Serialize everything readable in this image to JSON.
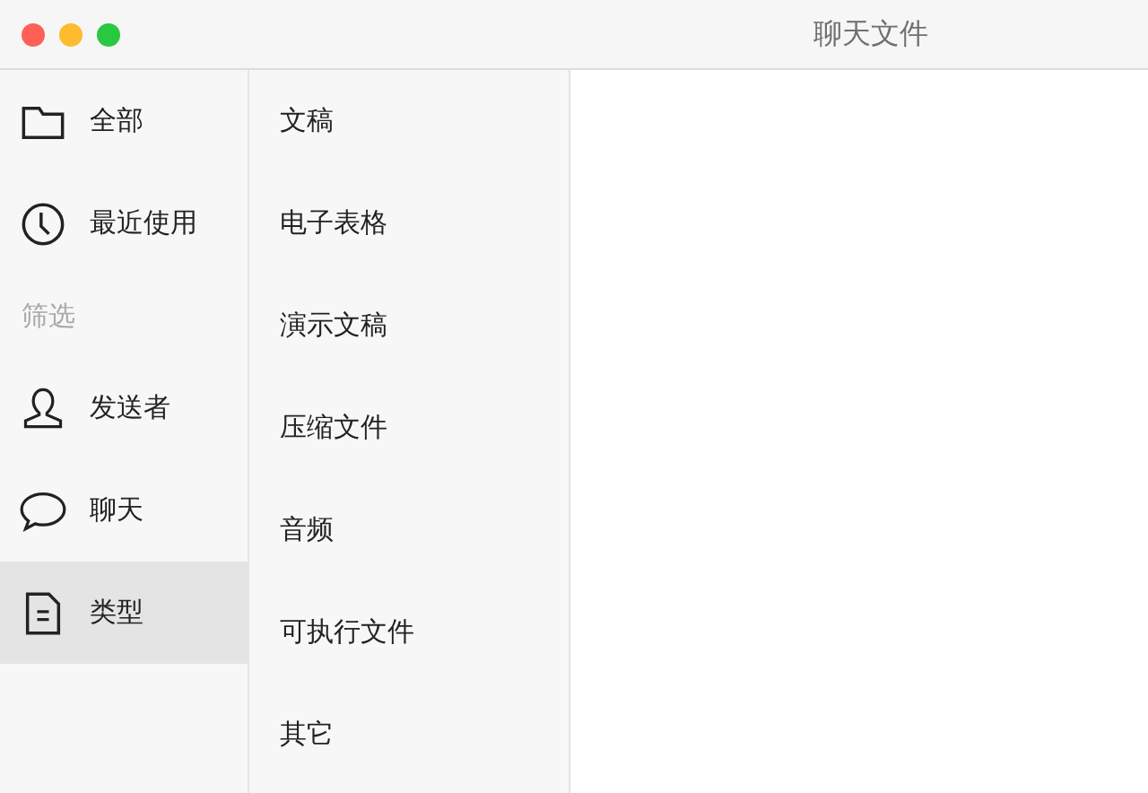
{
  "window": {
    "title": "聊天文件"
  },
  "sidebar": {
    "items": [
      {
        "kind": "item",
        "label": "全部",
        "selected": false
      },
      {
        "kind": "item",
        "label": "最近使用",
        "selected": false
      },
      {
        "kind": "header",
        "label": "筛选"
      },
      {
        "kind": "item",
        "label": "发送者",
        "selected": false
      },
      {
        "kind": "item",
        "label": "聊天",
        "selected": false
      },
      {
        "kind": "item",
        "label": "类型",
        "selected": true
      }
    ]
  },
  "file_types": {
    "items": [
      {
        "label": "文稿",
        "selected": false
      },
      {
        "label": "电子表格",
        "selected": false
      },
      {
        "label": "演示文稿",
        "selected": false
      },
      {
        "label": "压缩文件",
        "selected": false
      },
      {
        "label": "音频",
        "selected": false
      },
      {
        "label": "可执行文件",
        "selected": false
      },
      {
        "label": "其它",
        "selected": false
      }
    ]
  }
}
